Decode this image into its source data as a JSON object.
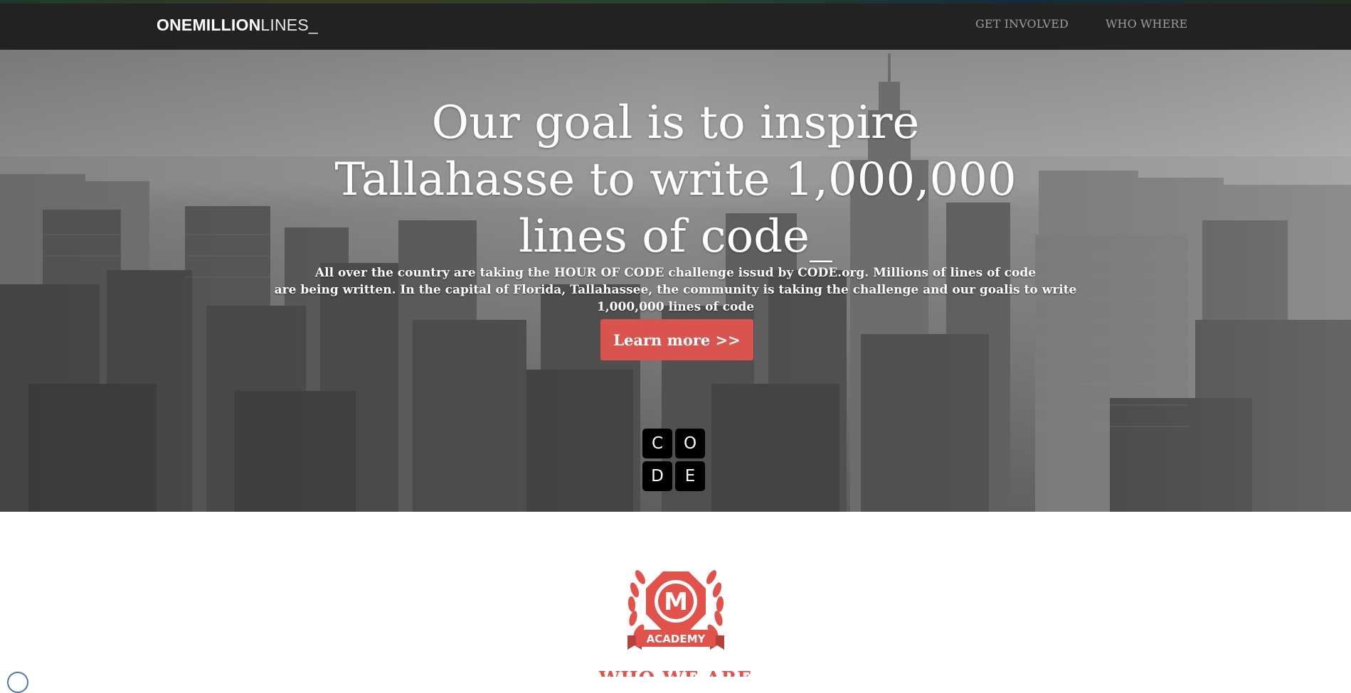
{
  "nav": {
    "brand_bold": "ONEMILLION",
    "brand_light": "LINES_",
    "links": [
      "GET INVOLVED",
      "WHO WHERE"
    ]
  },
  "hero": {
    "title_lines": [
      "Our goal is to inspire",
      "Tallahasse to write 1,000,000",
      "lines of code_"
    ],
    "text_lines": [
      "All over the country are taking the HOUR OF CODE challenge issud by CODE.org. Millions of lines of code",
      "are being written. In the capital of Florida, Tallahassee, the community is taking the challenge and our goalis to write",
      "1,000,000 lines of code"
    ],
    "button_label": "Learn more >>",
    "code_letters": [
      "C",
      "O",
      "D",
      "E"
    ]
  },
  "academy": {
    "monogram": "M",
    "ribbon": "ACADEMY",
    "heading": "WHO WE ARE"
  },
  "colors": {
    "navbar": "#222222",
    "accent": "#d9534f",
    "nav_link": "#9d9d9d"
  }
}
